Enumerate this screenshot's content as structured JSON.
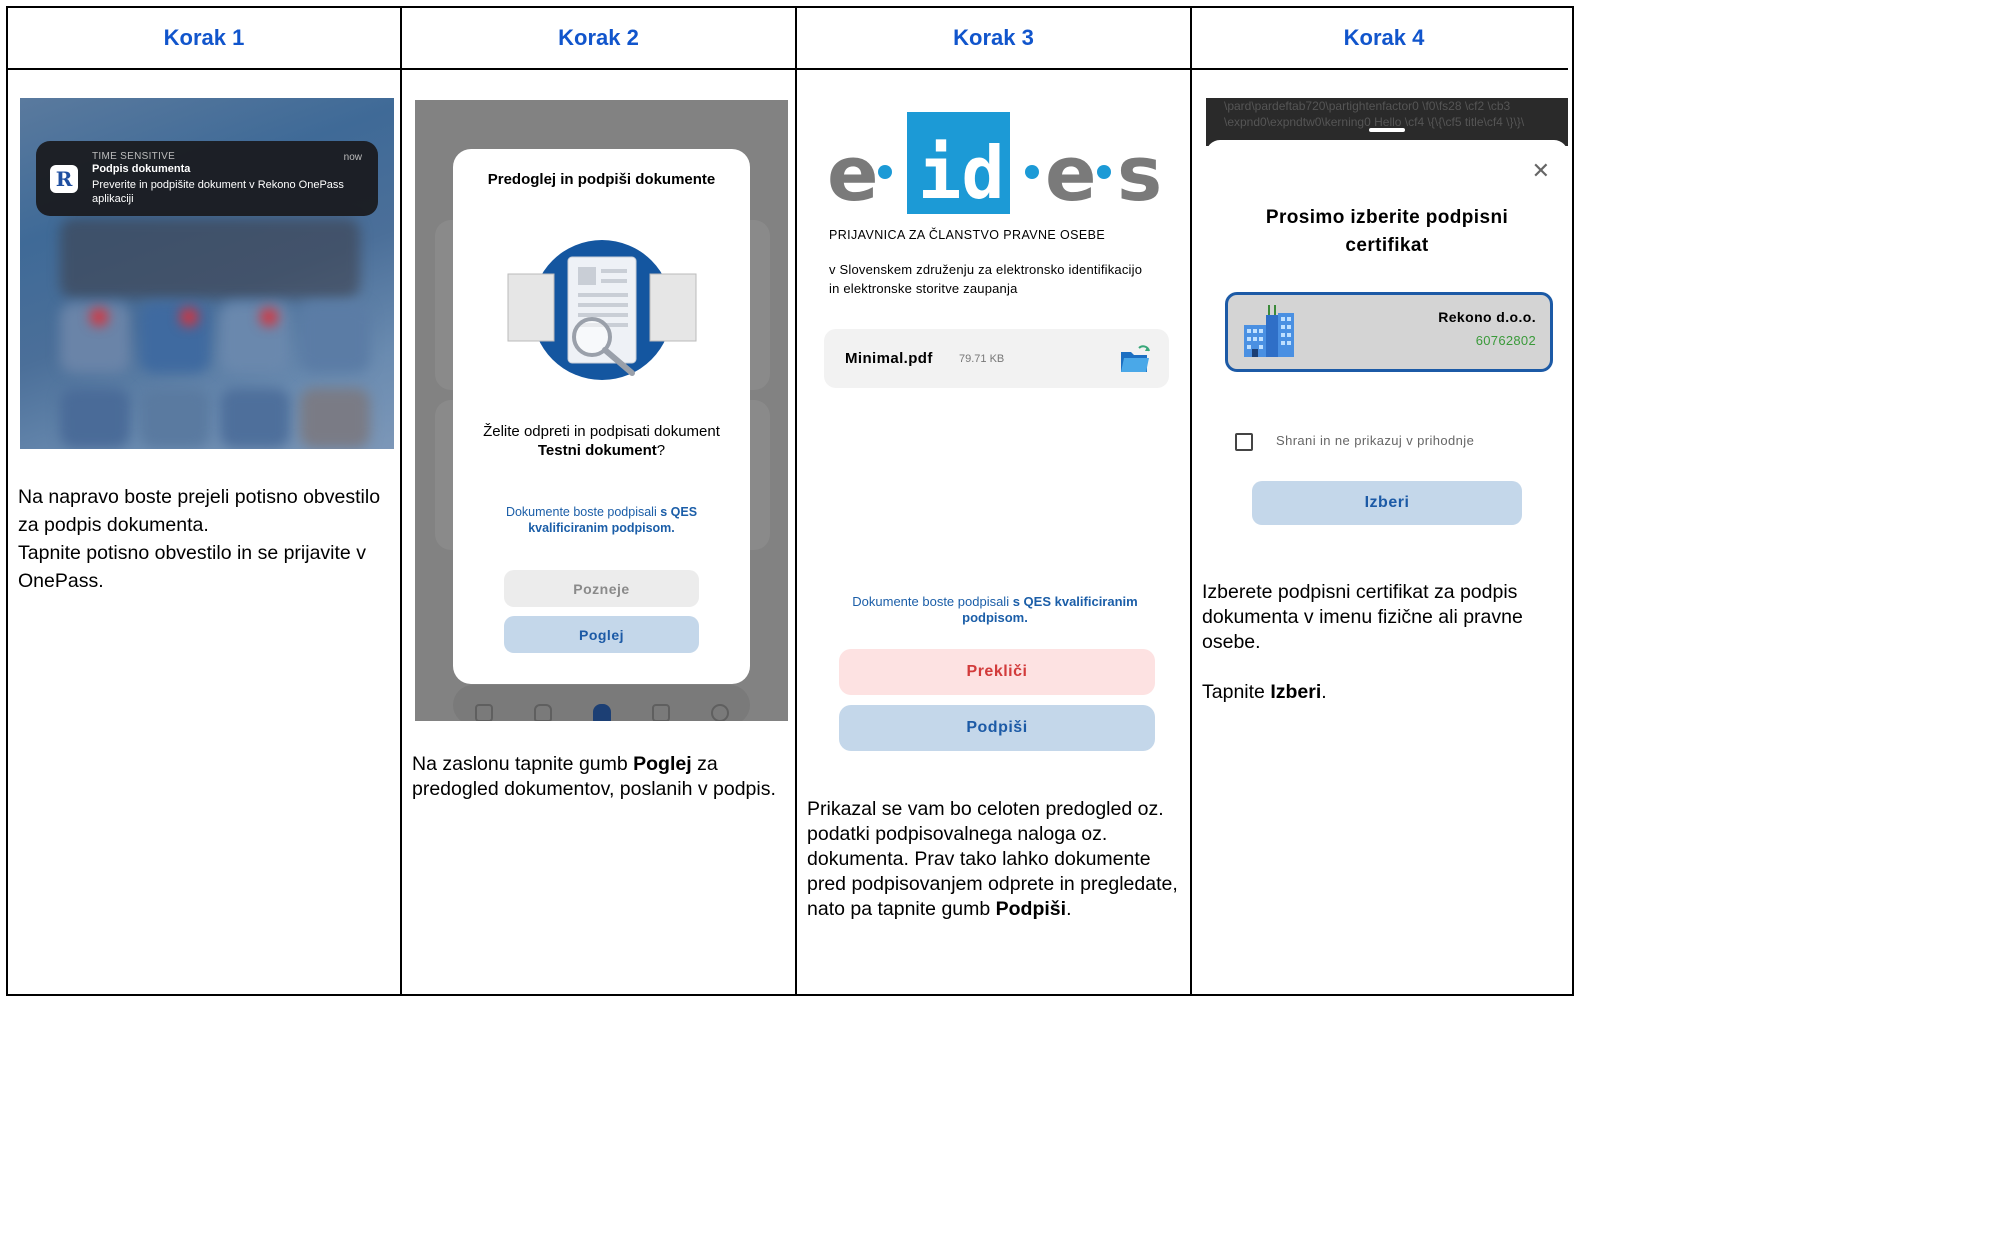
{
  "headers": [
    "Korak 1",
    "Korak 2",
    "Korak 3",
    "Korak 4"
  ],
  "step1": {
    "notification": {
      "tag": "TIME SENSITIVE",
      "time": "now",
      "title": "Podpis dokumenta",
      "body": "Preverite in podpišite dokument v Rekono OnePass aplikaciji",
      "app_icon": "rekono-app-icon"
    },
    "description": [
      "Na napravo boste prejeli potisno obvestilo za podpis dokumenta.",
      "Tapnite potisno obvestilo in se prijavite v OnePass."
    ]
  },
  "step2": {
    "modal_title": "Predoglej in podpiši dokumente",
    "question_prefix": "Želite odpreti in podpisati dokument",
    "document_name": "Testni dokument",
    "question_suffix": "?",
    "note_prefix": "Dokumente boste podpisali ",
    "note_bold": "s QES kvalificiranim podpisom.",
    "later_button": "Pozneje",
    "view_button": "Poglej",
    "description_before": "Na zaslonu tapnite gumb ",
    "description_bold": "Poglej",
    "description_after": " za predogled dokumentov, poslanih v podpis."
  },
  "step3": {
    "logo_text": [
      "e",
      "id",
      "e",
      "s"
    ],
    "form_title": "PRIJAVNICA ZA ČLANSTVO PRAVNE OSEBE",
    "subtitle": "v Slovenskem združenju za elektronsko identifikacijo in elektronske storitve zaupanja",
    "file_name": "Minimal.pdf",
    "file_size": "79.71 KB",
    "note_prefix": "Dokumente boste podpisali ",
    "note_bold": "s QES kvalificiranim podpisom.",
    "cancel_button": "Prekliči",
    "sign_button": "Podpiši",
    "description_before": "Prikazal se vam bo celoten predogled oz. podatki podpisovalnega naloga oz. dokumenta. Prav tako lahko dokumente pred podpisovanjem odprete in pregledate, nato pa tapnite gumb ",
    "description_bold": "Podpiši",
    "description_after": ".",
    "colors": {
      "cancel_bg": "#fde2e2",
      "cancel_text": "#d23b3b",
      "sign_bg": "#c4d7ea",
      "sign_text": "#1c5aa6"
    }
  },
  "step4": {
    "background_code": "\\pard\\pardeftab720\\partightenfactor0 \\f0\\fs28 \\cf2 \\cb3 \\expnd0\\expndtw0\\kerning0 Hello \\cf4 \\{\\{\\cf5 title\\cf4 \\}\\}\\",
    "sheet_title": "Prosimo izberite podpisni certifikat",
    "certificate_name": "Rekono d.o.o.",
    "certificate_id": "60762802",
    "checkbox_label": "Shrani in ne prikazuj v prihodnje",
    "select_button": "Izberi",
    "description_1": "Izberete podpisni certifikat za podpis dokumenta v imenu fizične ali pravne osebe.",
    "description_2_before": "Tapnite ",
    "description_2_bold": "Izberi",
    "description_2_after": "."
  },
  "colors": {
    "header_blue": "#1155cc",
    "link_blue": "#1b5ea8"
  }
}
